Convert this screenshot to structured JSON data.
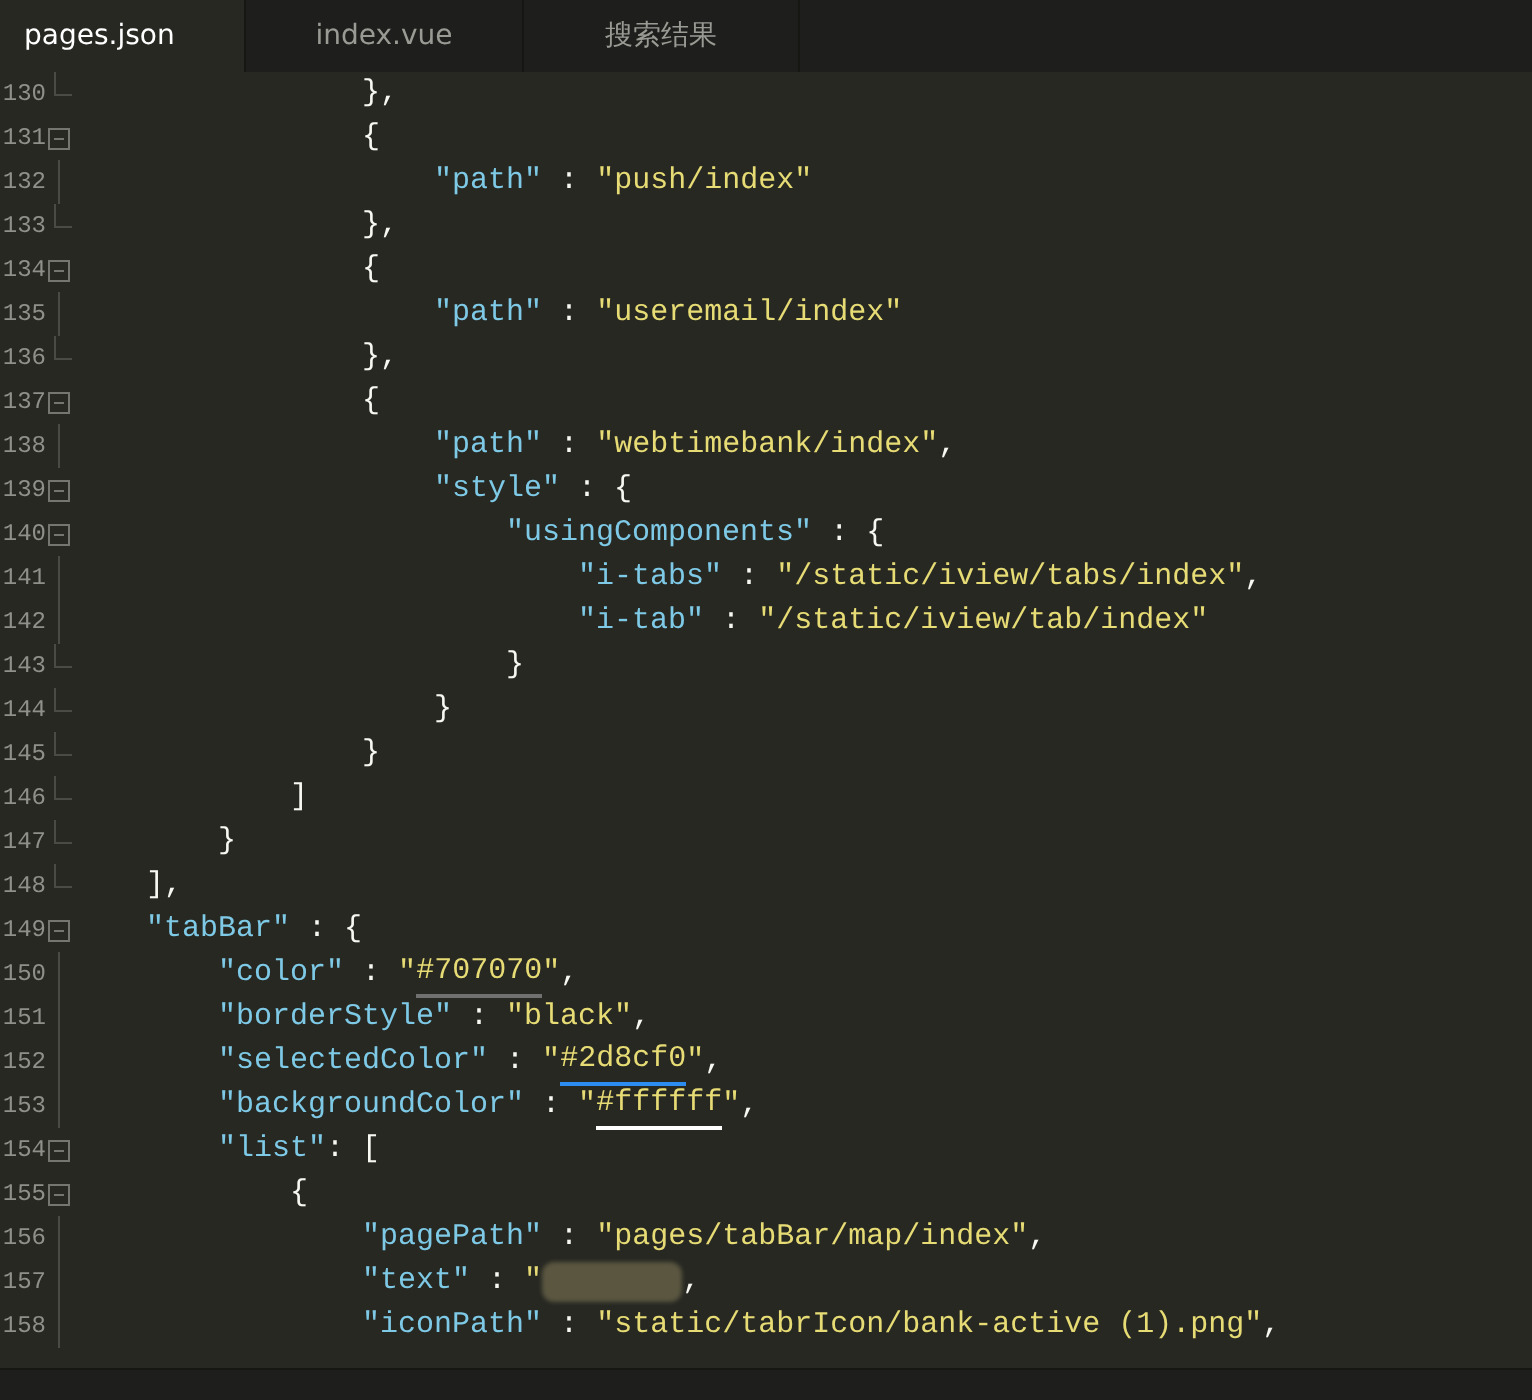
{
  "tabs": [
    {
      "label": "pages.json",
      "selected": true
    },
    {
      "label": "index.vue",
      "selected": false
    },
    {
      "label": "搜索结果",
      "selected": false
    }
  ],
  "lines": [
    {
      "number": "130",
      "kind": "end",
      "tokens": [
        {
          "kind": "punct",
          "text": "            },"
        }
      ]
    },
    {
      "number": "131",
      "kind": "fold",
      "tokens": [
        {
          "kind": "punct",
          "text": "            {"
        }
      ]
    },
    {
      "number": "132",
      "kind": "line",
      "tokens": [
        {
          "kind": "key",
          "text": "                \"path\""
        },
        {
          "kind": "punct",
          "text": " : "
        },
        {
          "kind": "string",
          "text": "\"push/index\""
        }
      ]
    },
    {
      "number": "133",
      "kind": "end",
      "tokens": [
        {
          "kind": "punct",
          "text": "            },"
        }
      ]
    },
    {
      "number": "134",
      "kind": "fold",
      "tokens": [
        {
          "kind": "punct",
          "text": "            {"
        }
      ]
    },
    {
      "number": "135",
      "kind": "line",
      "tokens": [
        {
          "kind": "key",
          "text": "                \"path\""
        },
        {
          "kind": "punct",
          "text": " : "
        },
        {
          "kind": "string",
          "text": "\"useremail/index\""
        }
      ]
    },
    {
      "number": "136",
      "kind": "end",
      "tokens": [
        {
          "kind": "punct",
          "text": "            },"
        }
      ]
    },
    {
      "number": "137",
      "kind": "fold",
      "tokens": [
        {
          "kind": "punct",
          "text": "            {"
        }
      ]
    },
    {
      "number": "138",
      "kind": "line",
      "tokens": [
        {
          "kind": "key",
          "text": "                \"path\""
        },
        {
          "kind": "punct",
          "text": " : "
        },
        {
          "kind": "string",
          "text": "\"webtimebank/index\""
        },
        {
          "kind": "punct",
          "text": ","
        }
      ]
    },
    {
      "number": "139",
      "kind": "fold",
      "tokens": [
        {
          "kind": "key",
          "text": "                \"style\""
        },
        {
          "kind": "punct",
          "text": " : {"
        }
      ]
    },
    {
      "number": "140",
      "kind": "fold",
      "tokens": [
        {
          "kind": "key",
          "text": "                    \"usingComponents\""
        },
        {
          "kind": "punct",
          "text": " : {"
        }
      ]
    },
    {
      "number": "141",
      "kind": "line",
      "tokens": [
        {
          "kind": "key",
          "text": "                        \"i-tabs\""
        },
        {
          "kind": "punct",
          "text": " : "
        },
        {
          "kind": "string",
          "text": "\"/static/iview/tabs/index\""
        },
        {
          "kind": "punct",
          "text": ","
        }
      ]
    },
    {
      "number": "142",
      "kind": "line",
      "tokens": [
        {
          "kind": "key",
          "text": "                        \"i-tab\""
        },
        {
          "kind": "punct",
          "text": " : "
        },
        {
          "kind": "string",
          "text": "\"/static/iview/tab/index\""
        }
      ]
    },
    {
      "number": "143",
      "kind": "end",
      "tokens": [
        {
          "kind": "punct",
          "text": "                    }"
        }
      ]
    },
    {
      "number": "144",
      "kind": "end",
      "tokens": [
        {
          "kind": "punct",
          "text": "                }"
        }
      ]
    },
    {
      "number": "145",
      "kind": "end",
      "tokens": [
        {
          "kind": "punct",
          "text": "            }"
        }
      ]
    },
    {
      "number": "146",
      "kind": "end",
      "tokens": [
        {
          "kind": "punct",
          "text": "        ]"
        }
      ]
    },
    {
      "number": "147",
      "kind": "end",
      "tokens": [
        {
          "kind": "punct",
          "text": "    }"
        }
      ]
    },
    {
      "number": "148",
      "kind": "end",
      "tokens": [
        {
          "kind": "punct",
          "text": "],"
        }
      ]
    },
    {
      "number": "149",
      "kind": "fold",
      "tokens": [
        {
          "kind": "key",
          "text": "\"tabBar\""
        },
        {
          "kind": "punct",
          "text": " : {"
        }
      ]
    },
    {
      "number": "150",
      "kind": "line",
      "tokens": [
        {
          "kind": "key",
          "text": "    \"color\""
        },
        {
          "kind": "punct",
          "text": " : "
        },
        {
          "kind": "string",
          "text": "\""
        },
        {
          "kind": "string",
          "text": "#707070",
          "color": "#707070"
        },
        {
          "kind": "string",
          "text": "\""
        },
        {
          "kind": "punct",
          "text": ","
        }
      ]
    },
    {
      "number": "151",
      "kind": "line",
      "tokens": [
        {
          "kind": "key",
          "text": "    \"borderStyle\""
        },
        {
          "kind": "punct",
          "text": " : "
        },
        {
          "kind": "string",
          "text": "\"black\""
        },
        {
          "kind": "punct",
          "text": ","
        }
      ]
    },
    {
      "number": "152",
      "kind": "line",
      "tokens": [
        {
          "kind": "key",
          "text": "    \"selectedColor\""
        },
        {
          "kind": "punct",
          "text": " : "
        },
        {
          "kind": "string",
          "text": "\""
        },
        {
          "kind": "string",
          "text": "#2d8cf0",
          "color": "#2d8cf0"
        },
        {
          "kind": "string",
          "text": "\""
        },
        {
          "kind": "punct",
          "text": ","
        }
      ]
    },
    {
      "number": "153",
      "kind": "line",
      "tokens": [
        {
          "kind": "key",
          "text": "    \"backgroundColor\""
        },
        {
          "kind": "punct",
          "text": " : "
        },
        {
          "kind": "string",
          "text": "\""
        },
        {
          "kind": "string",
          "text": "#ffffff",
          "color": "#ffffff"
        },
        {
          "kind": "string",
          "text": "\""
        },
        {
          "kind": "punct",
          "text": ","
        }
      ]
    },
    {
      "number": "154",
      "kind": "fold",
      "tokens": [
        {
          "kind": "key",
          "text": "    \"list\""
        },
        {
          "kind": "punct",
          "text": ": ["
        }
      ]
    },
    {
      "number": "155",
      "kind": "fold",
      "tokens": [
        {
          "kind": "punct",
          "text": "        {"
        }
      ]
    },
    {
      "number": "156",
      "kind": "line",
      "tokens": [
        {
          "kind": "key",
          "text": "            \"pagePath\""
        },
        {
          "kind": "punct",
          "text": " : "
        },
        {
          "kind": "string",
          "text": "\"pages/tabBar/map/index\""
        },
        {
          "kind": "punct",
          "text": ","
        }
      ]
    },
    {
      "number": "157",
      "kind": "line",
      "tokens": [
        {
          "kind": "key",
          "text": "            \"text\""
        },
        {
          "kind": "punct",
          "text": " : "
        },
        {
          "kind": "string",
          "text": "\""
        },
        {
          "kind": "redacted"
        },
        {
          "kind": "punct",
          "text": ","
        }
      ]
    },
    {
      "number": "158",
      "kind": "line",
      "tokens": [
        {
          "kind": "key",
          "text": "            \"iconPath\""
        },
        {
          "kind": "punct",
          "text": " : "
        },
        {
          "kind": "string",
          "text": "\"static/tabrIcon/bank-active (1).png\""
        },
        {
          "kind": "punct",
          "text": ","
        }
      ]
    }
  ]
}
